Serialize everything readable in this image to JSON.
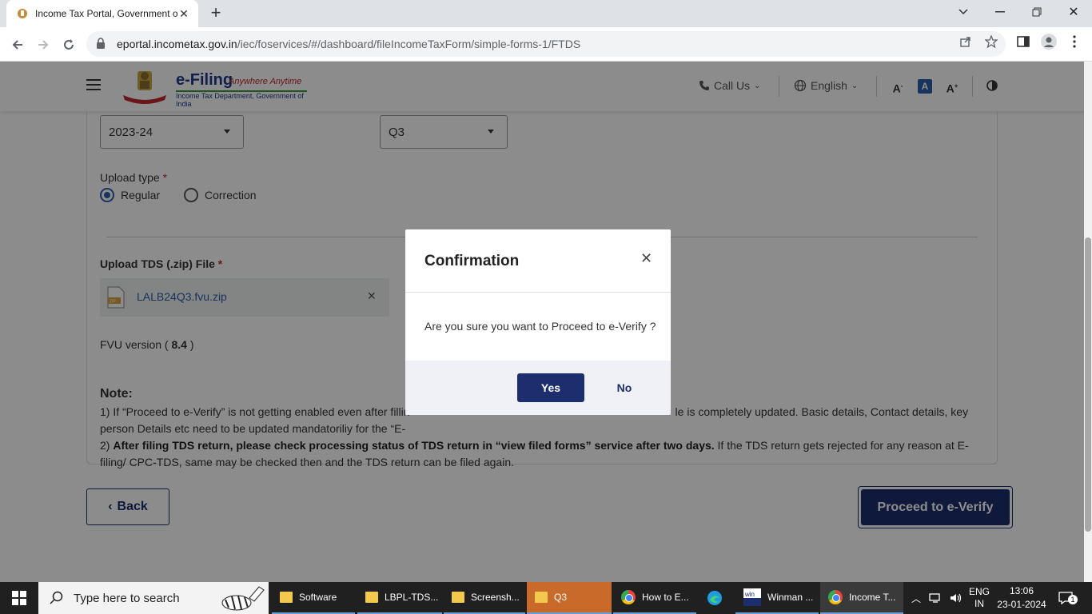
{
  "browser": {
    "tab_title": "Income Tax Portal, Government of India",
    "url_host": "eportal.incometax.gov.in",
    "url_path": "/iec/foservices/#/dashboard/fileIncomeTaxForm/simple-forms-1/FTDS"
  },
  "header": {
    "logo_title": "e-Filing",
    "logo_tagline": "Anywhere Anytime",
    "logo_sub": "Income Tax Department, Government of India",
    "call_us": "Call Us",
    "language": "English",
    "font_decrease": "A",
    "font_normal": "A",
    "font_increase": "A"
  },
  "form": {
    "financial_year": "2023-24",
    "quarter": "Q3",
    "upload_type_label": "Upload type",
    "required_mark": "*",
    "radio_regular": "Regular",
    "radio_correction": "Correction",
    "upload_file_label": "Upload TDS (.zip) File",
    "file_name": "LALB24Q3.fvu.zip",
    "fvu_prefix": "FVU version (",
    "fvu_version": "8.4",
    "fvu_suffix": ")"
  },
  "note": {
    "heading": "Note:",
    "line1_start": "1) If “Proceed to e-Verify” is not getting enabled even after fillin",
    "line1_end": "le is completely updated. Basic details, Contact details, key",
    "line1_cont_start": "person Details etc need to be updated mandatoriliy for the “E-",
    "line2_bold": "After filing TDS return, please check processing status of TDS return in “view filed forms” service after two days.",
    "line2_prefix": "2) ",
    "line2_rest": " If the TDS return gets rejected for any reason at E-filing/ CPC-TDS, same may be checked then and the TDS return can be filed again."
  },
  "actions": {
    "back": "Back",
    "proceed": "Proceed to e-Verify"
  },
  "modal": {
    "title": "Confirmation",
    "message": "Are you sure you want to Proceed to e-Verify ?",
    "yes": "Yes",
    "no": "No"
  },
  "taskbar": {
    "search_placeholder": "Type here to search",
    "apps": [
      "Software",
      "LBPL-TDS...",
      "Screensh...",
      "Q3",
      "How to E...",
      "Winman ...",
      "Income T..."
    ],
    "lang_top": "ENG",
    "lang_bottom": "IN",
    "time": "13:06",
    "date": "23-01-2024",
    "notifications": "1"
  },
  "colors": {
    "primary": "#1d2e6e",
    "link": "#2c5fa8",
    "required": "#c1272d",
    "active_taskbar": "#c96a2a"
  }
}
